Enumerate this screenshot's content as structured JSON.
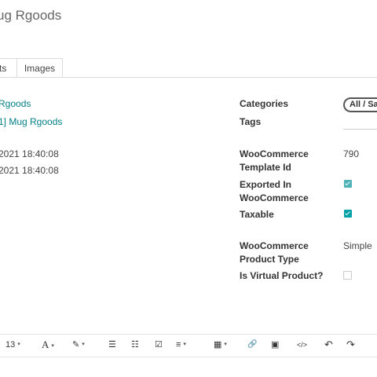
{
  "product": {
    "title_visible": "ug Rgoods"
  },
  "tabs": {
    "left_partial": "ts",
    "images": "Images"
  },
  "left_fields": {
    "link1": "Rgoods",
    "link2": "1] Mug Rgoods",
    "date1": "2021 18:40:08",
    "date2": "2021 18:40:08"
  },
  "right_fields": {
    "categories_label": "Categories",
    "categories_value": "All / Sal",
    "tags_label": "Tags",
    "template_label": "WooCommerce Template Id",
    "template_value": "790",
    "exported_label": "Exported In WooCommerce",
    "exported_checked": true,
    "taxable_label": "Taxable",
    "taxable_checked": true,
    "product_type_label": "WooCommerce Product Type",
    "product_type_value": "Simple",
    "virtual_label": "Is Virtual Product?",
    "virtual_checked": false
  },
  "toolbar": {
    "font_size": "13",
    "caret": "▾",
    "font_color_icon": "A",
    "brush_icon": "✎",
    "ul_icon": "☰",
    "ol_icon": "☷",
    "checklist_icon": "☑",
    "align_icon": "≡",
    "table_icon": "▦",
    "link_icon": "🔗",
    "image_icon": "▣",
    "code_icon": "</>",
    "undo_icon": "↶",
    "redo_icon": "↷"
  }
}
